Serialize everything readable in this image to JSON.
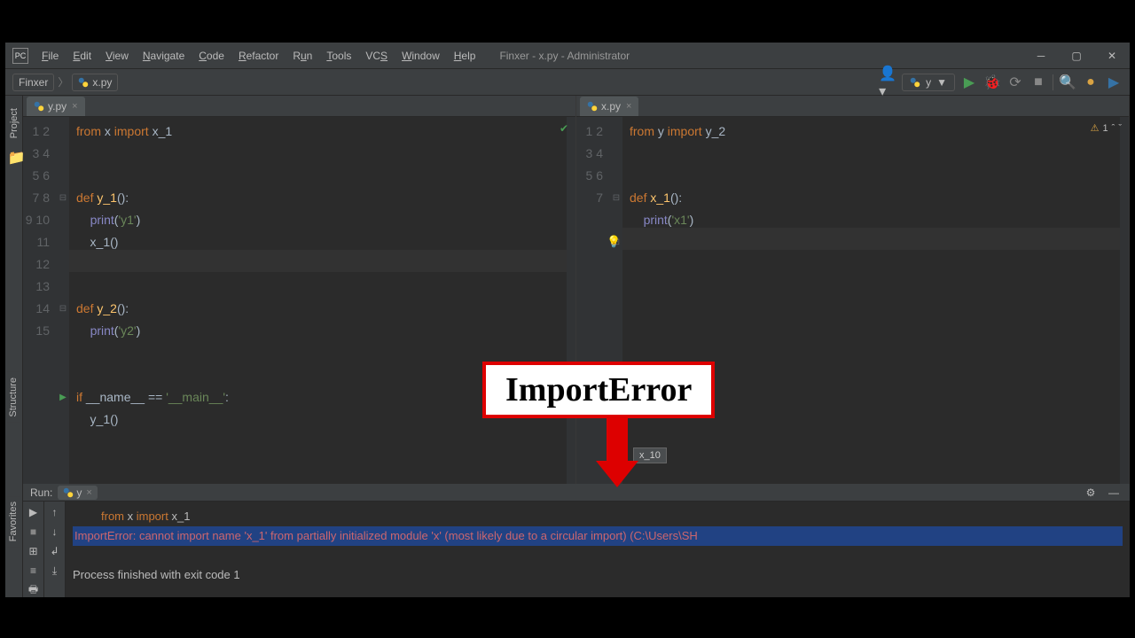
{
  "menu": [
    "File",
    "Edit",
    "View",
    "Navigate",
    "Code",
    "Refactor",
    "Run",
    "Tools",
    "VCS",
    "Window",
    "Help"
  ],
  "title": "Finxer - x.py - Administrator",
  "breadcrumb": {
    "project": "Finxer",
    "file": "x.py"
  },
  "runconfig": "y",
  "tabs": {
    "left": "y.py",
    "right": "x.py"
  },
  "warn_count": "1",
  "code_left": {
    "lines": [
      "1",
      "2",
      "3",
      "4",
      "5",
      "6",
      "7",
      "8",
      "9",
      "10",
      "11",
      "12",
      "13",
      "14",
      "15"
    ]
  },
  "code_right": {
    "lines": [
      "1",
      "2",
      "3",
      "4",
      "5",
      "6",
      "7"
    ]
  },
  "tooltip": "x_10",
  "annotation": "ImportError",
  "run": {
    "label": "Run:",
    "tab": "y",
    "line1_prefix": "from",
    "line1_mid": " x ",
    "line1_import": "import",
    "line1_end": " x_1",
    "error": "ImportError: cannot import name 'x_1' from partially initialized module 'x' (most likely due to a circular import) (C:\\Users\\SH",
    "exit": "Process finished with exit code 1"
  },
  "side_tabs": {
    "project": "Project",
    "structure": "Structure",
    "favorites": "Favorites"
  }
}
